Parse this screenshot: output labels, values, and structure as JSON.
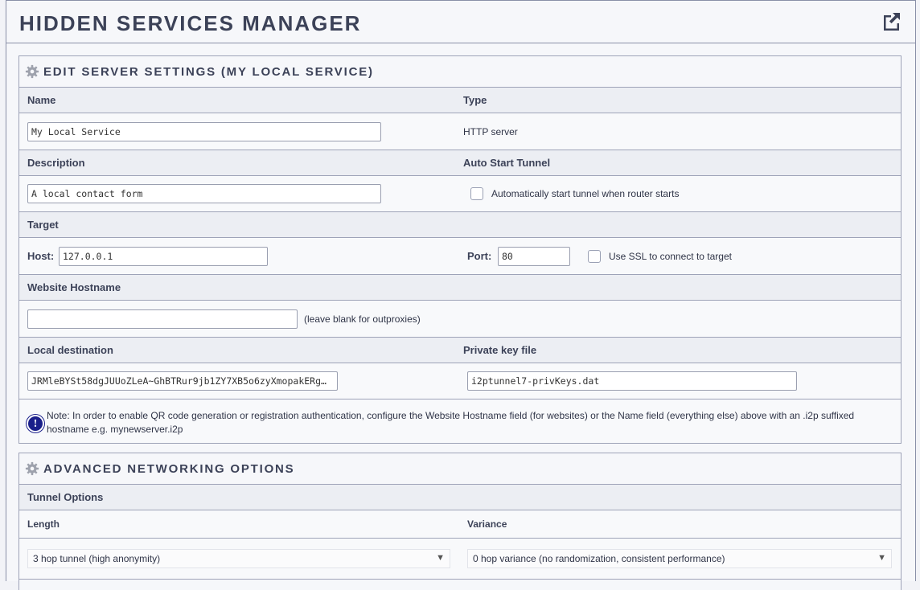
{
  "page": {
    "title": "HIDDEN SERVICES MANAGER"
  },
  "icons": {
    "popout": "external-link-icon",
    "gear": "gear-icon",
    "note": "info-icon"
  },
  "server_settings": {
    "title": "EDIT SERVER SETTINGS (MY LOCAL SERVICE)",
    "name_label": "Name",
    "name_value": "My Local Service",
    "type_label": "Type",
    "type_value": "HTTP server",
    "description_label": "Description",
    "description_value": "A local contact form",
    "autostart_label": "Auto Start Tunnel",
    "autostart_text": "Automatically start tunnel when router starts",
    "target_label": "Target",
    "host_label": "Host:",
    "host_value": "127.0.0.1",
    "port_label": "Port:",
    "port_value": "80",
    "ssl_text": "Use SSL to connect to target",
    "hostname_label": "Website Hostname",
    "hostname_value": "",
    "hostname_hint": "(leave blank for outproxies)",
    "local_dest_label": "Local destination",
    "local_dest_value": "JRMleBYSt58dgJUUoZLeA~GhBTRur9jb1ZY7XB5o6zyXmopakERg…",
    "private_key_label": "Private key file",
    "private_key_value": "i2ptunnel7-privKeys.dat",
    "note_text": "Note: In order to enable QR code generation or registration authentication, configure the Website Hostname field (for websites) or the Name field (everything else) above with an .i2p suffixed hostname e.g. mynewserver.i2p"
  },
  "advanced": {
    "title": "ADVANCED NETWORKING OPTIONS",
    "tunnel_options_label": "Tunnel Options",
    "length_label": "Length",
    "variance_label": "Variance",
    "length_value": "3 hop tunnel (high anonymity)",
    "variance_value": "0 hop variance (no randomization, consistent performance)"
  },
  "colors": {
    "accent": "#3c4258",
    "note_icon": "#1a1f8a",
    "border": "#9ea3b8"
  }
}
